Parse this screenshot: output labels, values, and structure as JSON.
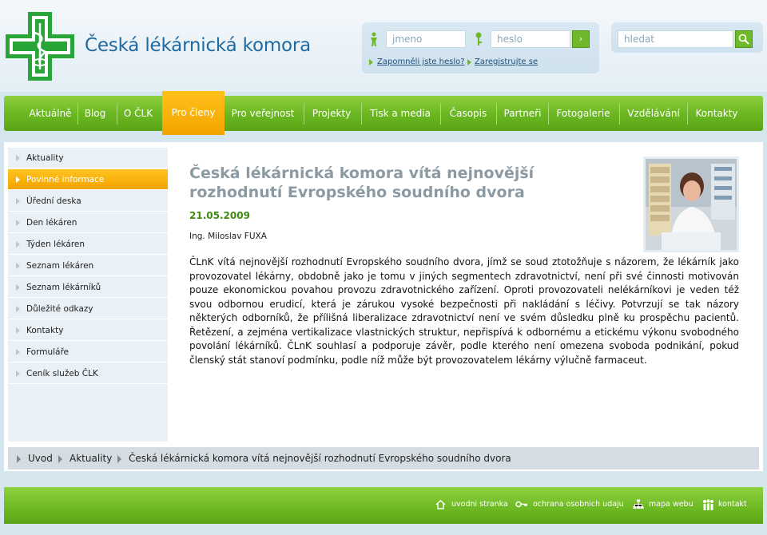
{
  "brand": {
    "name": "Česká lékárnická komora",
    "color": "#27a538"
  },
  "login": {
    "username_placeholder": "jmeno",
    "password_placeholder": "heslo",
    "forgot_link": "Zapomněli jste heslo?",
    "register_link": "Zaregistrujte se"
  },
  "search": {
    "placeholder": "hledat"
  },
  "nav": {
    "items": [
      {
        "label": "Aktuálně"
      },
      {
        "label": "Blog"
      },
      {
        "label": "O ČLK"
      },
      {
        "label": "Pro členy"
      },
      {
        "label": "Pro veřejnost"
      },
      {
        "label": "Projekty"
      },
      {
        "label": "Tisk a media"
      },
      {
        "label": "Časopis"
      },
      {
        "label": "Partneři"
      },
      {
        "label": "Fotogalerie"
      },
      {
        "label": "Vzdělávání"
      },
      {
        "label": "Kontakty"
      }
    ],
    "active_index": 3
  },
  "sidebar": {
    "items": [
      {
        "label": "Aktuality"
      },
      {
        "label": "Povinné informace"
      },
      {
        "label": "Úřední deska"
      },
      {
        "label": "Den lékáren"
      },
      {
        "label": "Týden lékáren"
      },
      {
        "label": "Seznam lékáren"
      },
      {
        "label": "Seznam lékárníků"
      },
      {
        "label": "Důležité odkazy"
      },
      {
        "label": "Kontakty"
      },
      {
        "label": "Formuláře"
      },
      {
        "label": "Ceník služeb ČLK"
      }
    ],
    "active_index": 1
  },
  "article": {
    "title": "Česká lékárnická komora vítá nejnovější rozhodnutí Evropského soudního dvora",
    "date": "21.05.2009",
    "author": "Ing. Miloslav FUXA",
    "body": "ČLnK vítá nejnovější rozhodnutí Evropského soudního dvora, jímž se soud ztotožňuje s názorem, že lékárník jako provozovatel lékárny, obdobně jako je tomu v jiných segmentech zdravotnictví, není při své činnosti motivován pouze ekonomickou povahou provozu zdravotnického zařízení. Oproti provozovateli nelékárníkovi je veden též svou odbornou erudicí, která je zárukou vysoké bezpečnosti při nakládání s léčivy. Potvrzují se tak názory některých odborníků, že přílišná liberalizace zdravotnictví není ve svém důsledku plně ku prospěchu pacientů. Řetězení, a zejména vertikalizace vlastnických struktur, nepřispívá k odbornému a etickému výkonu svobodného povolání lékárníků. ČLnK souhlasí a podporuje závěr, podle kterého není omezena svoboda podnikání, pokud členský stát stanoví podmínku, podle níž může být provozovatelem lékárny výlučně farmaceut."
  },
  "breadcrumb": [
    "Uvod",
    "Aktuality",
    "Česká lékárnická komora vítá nejnovější rozhodnutí Evropského soudního dvora"
  ],
  "footer": {
    "links": [
      "uvodni stranka",
      "ochrana osobnich udaju",
      "mapa webu",
      "kontakt"
    ]
  },
  "colors": {
    "nav_green": "#6cb823",
    "active_orange": "#f4a300",
    "title_gray": "#8c9aa3",
    "date_green": "#3f8a10"
  }
}
